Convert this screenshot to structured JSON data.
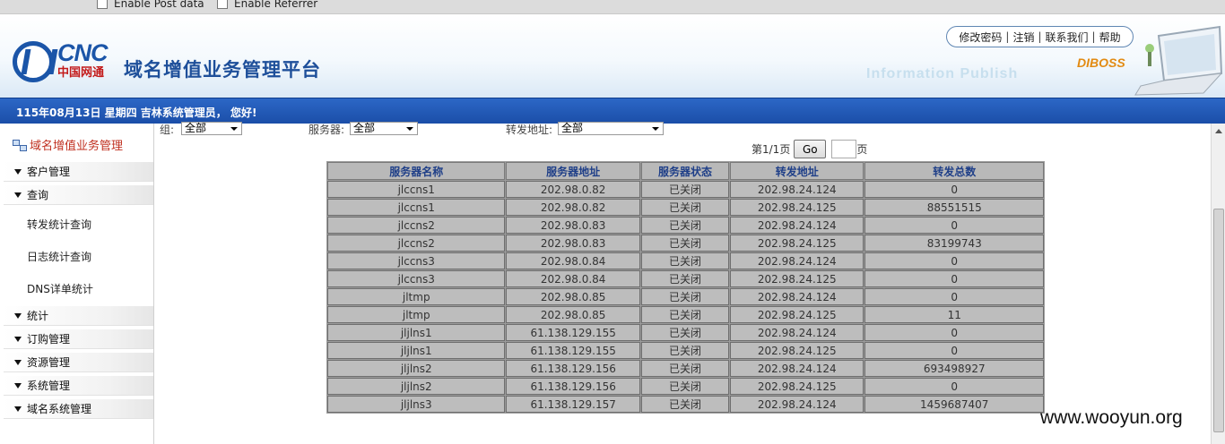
{
  "browser_options": {
    "post_data": "Enable Post data",
    "referrer": "Enable Referrer"
  },
  "header": {
    "logo_text": "CNC",
    "logo_sub": "中国网通",
    "system_title": "域名增值业务管理平台",
    "watermark": "Information Publish",
    "brand": "DIBOSS",
    "links": [
      "修改密码",
      "注销",
      "联系我们",
      "帮助"
    ]
  },
  "status_bar": {
    "text": "115年08月13日 星期四 吉林系统管理员， 您好!"
  },
  "sidebar": {
    "root": "域名增值业务管理",
    "groups": [
      "客户管理",
      "查询",
      "统计",
      "订购管理",
      "资源管理",
      "系统管理",
      "域名系统管理"
    ],
    "query_items": [
      "转发统计查询",
      "日志统计查询",
      "DNS详单统计"
    ]
  },
  "filters": {
    "group_label": "组:",
    "group_value": "全部",
    "server_label": "服务器:",
    "server_value": "全部",
    "forward_label": "转发地址:",
    "forward_value": "全部"
  },
  "pager": {
    "page_info": "第1/1页",
    "go_label": "Go",
    "page_suffix": "页"
  },
  "table": {
    "headers": [
      "服务器名称",
      "服务器地址",
      "服务器状态",
      "转发地址",
      "转发总数"
    ],
    "rows": [
      [
        "jlccns1",
        "202.98.0.82",
        "已关闭",
        "202.98.24.124",
        "0"
      ],
      [
        "jlccns1",
        "202.98.0.82",
        "已关闭",
        "202.98.24.125",
        "88551515"
      ],
      [
        "jlccns2",
        "202.98.0.83",
        "已关闭",
        "202.98.24.124",
        "0"
      ],
      [
        "jlccns2",
        "202.98.0.83",
        "已关闭",
        "202.98.24.125",
        "83199743"
      ],
      [
        "jlccns3",
        "202.98.0.84",
        "已关闭",
        "202.98.24.124",
        "0"
      ],
      [
        "jlccns3",
        "202.98.0.84",
        "已关闭",
        "202.98.24.125",
        "0"
      ],
      [
        "jltmp",
        "202.98.0.85",
        "已关闭",
        "202.98.24.124",
        "0"
      ],
      [
        "jltmp",
        "202.98.0.85",
        "已关闭",
        "202.98.24.125",
        "11"
      ],
      [
        "jljlns1",
        "61.138.129.155",
        "已关闭",
        "202.98.24.124",
        "0"
      ],
      [
        "jljlns1",
        "61.138.129.155",
        "已关闭",
        "202.98.24.125",
        "0"
      ],
      [
        "jljlns2",
        "61.138.129.156",
        "已关闭",
        "202.98.24.124",
        "693498927"
      ],
      [
        "jljlns2",
        "61.138.129.156",
        "已关闭",
        "202.98.24.125",
        "0"
      ],
      [
        "jljlns3",
        "61.138.129.157",
        "已关闭",
        "202.98.24.124",
        "1459687407"
      ]
    ]
  },
  "site_watermark": "www.wooyun.org"
}
